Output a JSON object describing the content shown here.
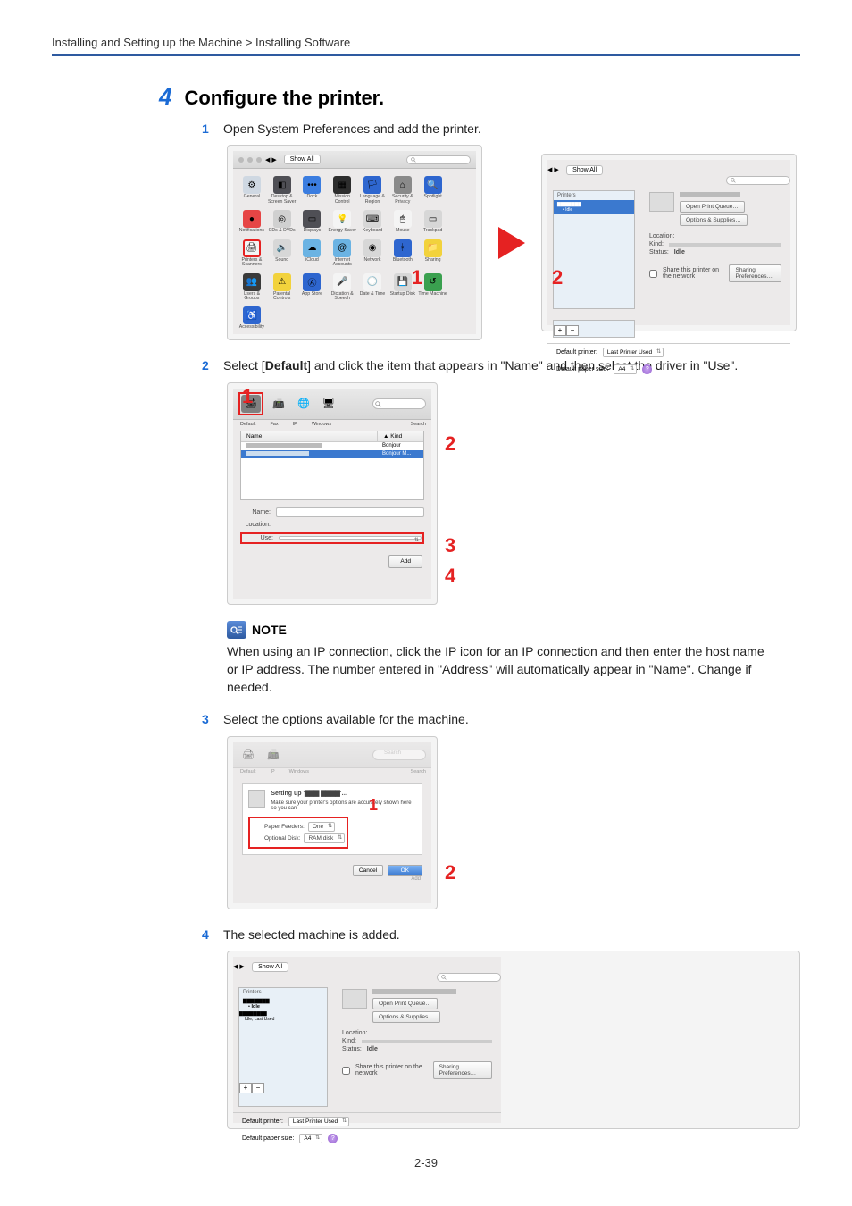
{
  "breadcrumb": {
    "section": "Installing and Setting up the Machine",
    "sep": ">",
    "subsection": "Installing Software"
  },
  "step4": {
    "num": "4",
    "title": "Configure the printer."
  },
  "sub1": {
    "num": "1",
    "text": "Open System Preferences and add the printer."
  },
  "sub2": {
    "num": "2",
    "text_a": "Select [",
    "bold": "Default",
    "text_b": "] and click the item that appears in \"Name\" and then select the driver in \"Use\"."
  },
  "sub3": {
    "num": "3",
    "text": "Select the options available for the machine."
  },
  "sub4": {
    "num": "4",
    "text": "The selected machine is added."
  },
  "callouts": {
    "one": "1",
    "two": "2",
    "three": "3",
    "four": "4"
  },
  "sysprefs": {
    "showall": "Show All",
    "icons": [
      {
        "label": "General",
        "bg": "#cfd8e2",
        "sym": "⚙"
      },
      {
        "label": "Desktop & Screen Saver",
        "bg": "#4f4f55",
        "sym": "◧"
      },
      {
        "label": "Dock",
        "bg": "#3b7de0",
        "sym": "•••"
      },
      {
        "label": "Mission Control",
        "bg": "#2d2d2d",
        "sym": "▦"
      },
      {
        "label": "Language & Region",
        "bg": "#2e66cf",
        "sym": "🏳"
      },
      {
        "label": "Security & Privacy",
        "bg": "#8a8a8a",
        "sym": "⌂"
      },
      {
        "label": "Spotlight",
        "bg": "#2e66cf",
        "sym": "🔍"
      },
      {
        "label": "Notifications",
        "bg": "#e64545",
        "sym": "●"
      },
      {
        "label": "CDs & DVDs",
        "bg": "#d0d0d0",
        "sym": "◎"
      },
      {
        "label": "Displays",
        "bg": "#4f4f55",
        "sym": "▭"
      },
      {
        "label": "Energy Saver",
        "bg": "#f4f4f4",
        "sym": "💡"
      },
      {
        "label": "Keyboard",
        "bg": "#d7d7d7",
        "sym": "⌨"
      },
      {
        "label": "Mouse",
        "bg": "#f4f4f4",
        "sym": "🖱"
      },
      {
        "label": "Trackpad",
        "bg": "#d7d7d7",
        "sym": "▭"
      },
      {
        "label": "Printers & Scanners",
        "bg": "#f4f4f4",
        "sym": "🖨"
      },
      {
        "label": "Sound",
        "bg": "#d7d7d7",
        "sym": "🔈"
      },
      {
        "label": "iCloud",
        "bg": "#6bb3e3",
        "sym": "☁"
      },
      {
        "label": "Internet Accounts",
        "bg": "#6bb3e3",
        "sym": "@"
      },
      {
        "label": "Network",
        "bg": "#d7d7d7",
        "sym": "◉"
      },
      {
        "label": "Bluetooth",
        "bg": "#2e66cf",
        "sym": "ᚼ"
      },
      {
        "label": "Sharing",
        "bg": "#f2d23c",
        "sym": "📁"
      },
      {
        "label": "Users & Groups",
        "bg": "#3a3a3a",
        "sym": "👥"
      },
      {
        "label": "Parental Controls",
        "bg": "#f2d23c",
        "sym": "⚠"
      },
      {
        "label": "App Store",
        "bg": "#2e66cf",
        "sym": "Ⓐ"
      },
      {
        "label": "Dictation & Speech",
        "bg": "#f4f4f4",
        "sym": "🎤"
      },
      {
        "label": "Date & Time",
        "bg": "#f4f4f4",
        "sym": "🕒"
      },
      {
        "label": "Startup Disk",
        "bg": "#d7d7d7",
        "sym": "💾"
      },
      {
        "label": "Time Machine",
        "bg": "#3aa04f",
        "sym": "↺"
      },
      {
        "label": "Accessibility",
        "bg": "#2e66cf",
        "sym": "♿"
      }
    ]
  },
  "printers_panel": {
    "side_hdr": "Printers",
    "idle": "Idle",
    "open_queue": "Open Print Queue…",
    "opts_supplies": "Options & Supplies…",
    "location": "Location:",
    "kind": "Kind:",
    "status": "Status:",
    "status_val": "Idle",
    "share_label": "Share this printer on the network",
    "share_btn": "Sharing Preferences…",
    "def_printer": "Default printer:",
    "def_printer_val": "Last Printer Used",
    "def_paper": "Default paper size:",
    "def_paper_val": "A4",
    "plus": "+",
    "minus": "−",
    "idle_last": "Idle, Last Used"
  },
  "add_printer": {
    "tab_fax": "Fax",
    "tab_ip": "IP",
    "tab_win": "Windows",
    "search_lbl": "Search",
    "col_name": "Name",
    "col_kind": "Kind",
    "row_kind1": "Bonjour",
    "f_name": "Name:",
    "f_loc": "Location:",
    "f_use": "Use:",
    "add_btn": "Add"
  },
  "opts_dialog": {
    "search_ph": "Search",
    "setting_up": "Setting up '",
    "msg": "Make sure your printer's options are accurately shown here so you can",
    "pf": "Paper Feeders:",
    "pf_val": "One",
    "od": "Optional Disk:",
    "od_val": "RAM disk",
    "cancel": "Cancel",
    "ok": "OK",
    "add_small": "Add"
  },
  "note": {
    "label": "NOTE",
    "text": "When using an IP connection, click the IP icon for an IP connection and then enter the host name or IP address. The number entered in \"Address\" will automatically appear in \"Name\". Change if needed."
  },
  "pagenum": "2-39"
}
